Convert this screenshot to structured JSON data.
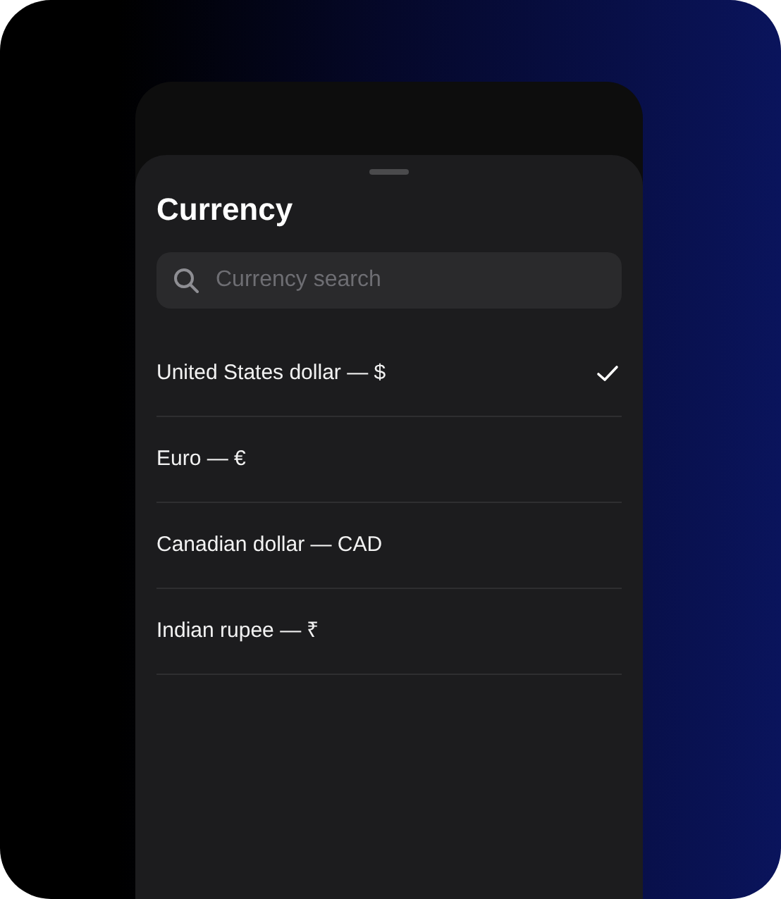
{
  "sheet": {
    "title": "Currency"
  },
  "search": {
    "placeholder": "Currency search"
  },
  "currencies": [
    {
      "label": "United States dollar — $",
      "selected": true
    },
    {
      "label": "Euro — €",
      "selected": false
    },
    {
      "label": "Canadian dollar — CAD",
      "selected": false
    },
    {
      "label": "Indian rupee — ₹",
      "selected": false
    }
  ]
}
